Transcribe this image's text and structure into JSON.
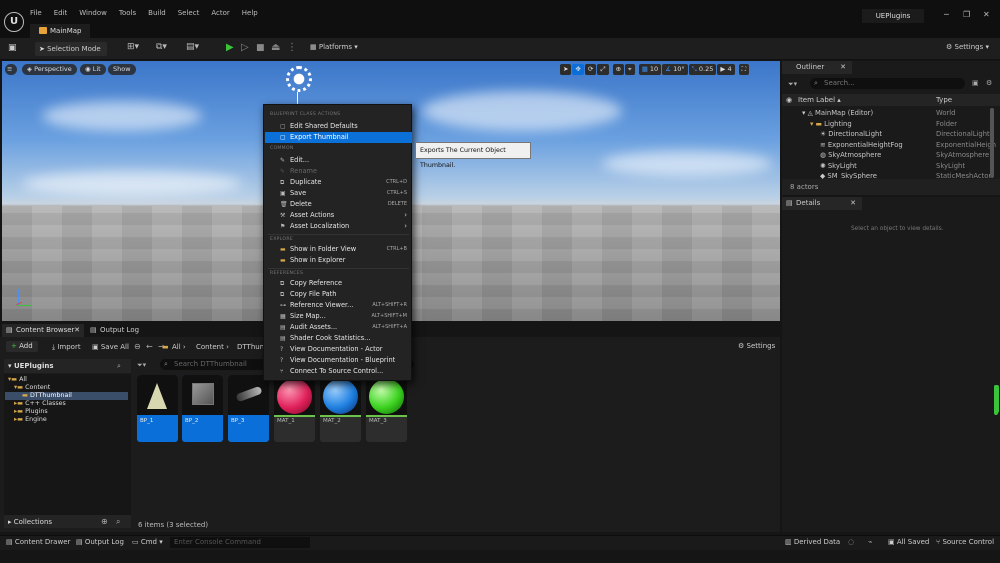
{
  "menu": [
    "File",
    "Edit",
    "Window",
    "Tools",
    "Build",
    "Select",
    "Actor",
    "Help"
  ],
  "tab_main": "MainMap",
  "project_name": "UEPlugins",
  "toolbar": {
    "selection_mode": "Selection Mode",
    "platforms": "Platforms",
    "settings": "Settings"
  },
  "viewport": {
    "perspective": "Perspective",
    "lit": "Lit",
    "show": "Show",
    "grid": "10",
    "angle": "10°",
    "scale": "0.25",
    "cam_speed": "4"
  },
  "outliner": {
    "title": "Outliner",
    "search": "Search...",
    "col_label": "Item Label",
    "col_type": "Type",
    "count": "8 actors",
    "rows": [
      {
        "label": "MainMap (Editor)",
        "type": "World"
      },
      {
        "label": "Lighting",
        "type": "Folder"
      },
      {
        "label": "DirectionalLight",
        "type": "DirectionalLight"
      },
      {
        "label": "ExponentialHeightFog",
        "type": "ExponentialHeigh"
      },
      {
        "label": "SkyAtmosphere",
        "type": "SkyAtmosphere"
      },
      {
        "label": "SkyLight",
        "type": "SkyLight"
      },
      {
        "label": "SM_SkySphere",
        "type": "StaticMeshActor"
      }
    ]
  },
  "details": {
    "title": "Details",
    "empty": "Select an object to view details."
  },
  "content_browser": {
    "tab": "Content Browser",
    "output_tab": "Output Log",
    "add": "Add",
    "import": "Import",
    "save_all": "Save All",
    "breadcrumb": [
      "All",
      "Content",
      "DTThum"
    ],
    "settings": "Settings",
    "search": "Search DTThumbnail",
    "root": "UEPlugins",
    "tree": [
      "All",
      "Content",
      "DTThumbnail",
      "C++ Classes",
      "Plugins",
      "Engine"
    ],
    "collections": "Collections",
    "status": "6 items (3 selected)",
    "assets": [
      "BP_1",
      "BP_2",
      "BP_3",
      "MAT_1",
      "MAT_2",
      "MAT_3"
    ]
  },
  "status": {
    "drawer": "Content Drawer",
    "output": "Output Log",
    "cmd": "Cmd",
    "console": "Enter Console Command",
    "derived": "Derived Data",
    "saved": "All Saved",
    "source": "Source Control"
  },
  "context_menu": {
    "h1": "BLUEPRINT CLASS ACTIONS",
    "edit_shared": "Edit Shared Defaults",
    "export": "Export Thumbnail",
    "h2": "COMMON",
    "edit": "Edit...",
    "rename": "Rename",
    "duplicate": "Duplicate",
    "dup_sc": "CTRL+D",
    "save": "Save",
    "save_sc": "CTRL+S",
    "delete": "Delete",
    "del_sc": "DELETE",
    "asset_actions": "Asset Actions",
    "asset_loc": "Asset Localization",
    "h3": "EXPLORE",
    "show_folder": "Show in Folder View",
    "sf_sc": "CTRL+B",
    "show_explorer": "Show in Explorer",
    "h4": "REFERENCES",
    "copy_ref": "Copy Reference",
    "copy_path": "Copy File Path",
    "ref_viewer": "Reference Viewer...",
    "rv_sc": "ALT+SHIFT+R",
    "size_map": "Size Map...",
    "sm_sc": "ALT+SHIFT+M",
    "audit": "Audit Assets...",
    "au_sc": "ALT+SHIFT+A",
    "shader": "Shader Cook Statistics...",
    "doc_actor": "View Documentation - Actor",
    "doc_bp": "View Documentation - Blueprint",
    "source": "Connect To Source Control..."
  },
  "tooltip": "Exports The Current Object Thumbnail."
}
